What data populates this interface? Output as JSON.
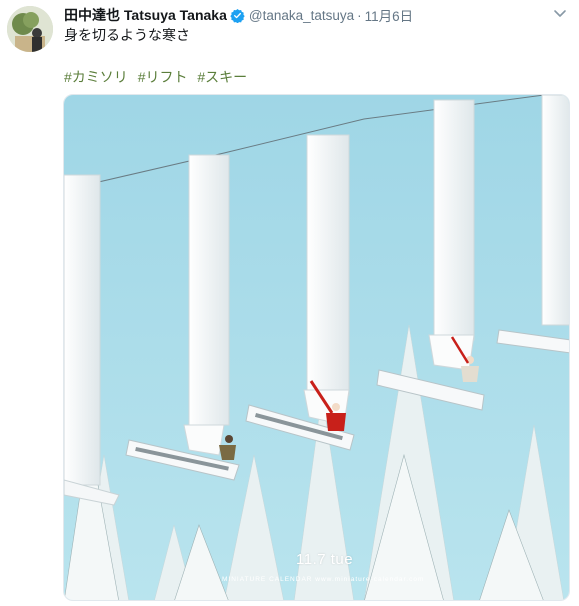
{
  "author": {
    "display_name": "田中達也 Tatsuya Tanaka",
    "handle": "@tanaka_tatsuya",
    "verified": true
  },
  "tweet": {
    "separator": "·",
    "timestamp": "11月6日",
    "text": "身を切るような寒さ",
    "hashtags": [
      "#カミソリ",
      "#リフト",
      "#スキー"
    ]
  },
  "media": {
    "date_caption": "11.7 tue",
    "calendar_caption": "MINIATURE CALENDAR  www.miniature-calendar.com"
  },
  "icons": {
    "verified": "verified-badge-icon",
    "caret": "chevron-down-icon"
  },
  "colors": {
    "sky": "#a9dbe9",
    "hashtag": "#5b7e3b",
    "verified": "#1da1f2"
  }
}
